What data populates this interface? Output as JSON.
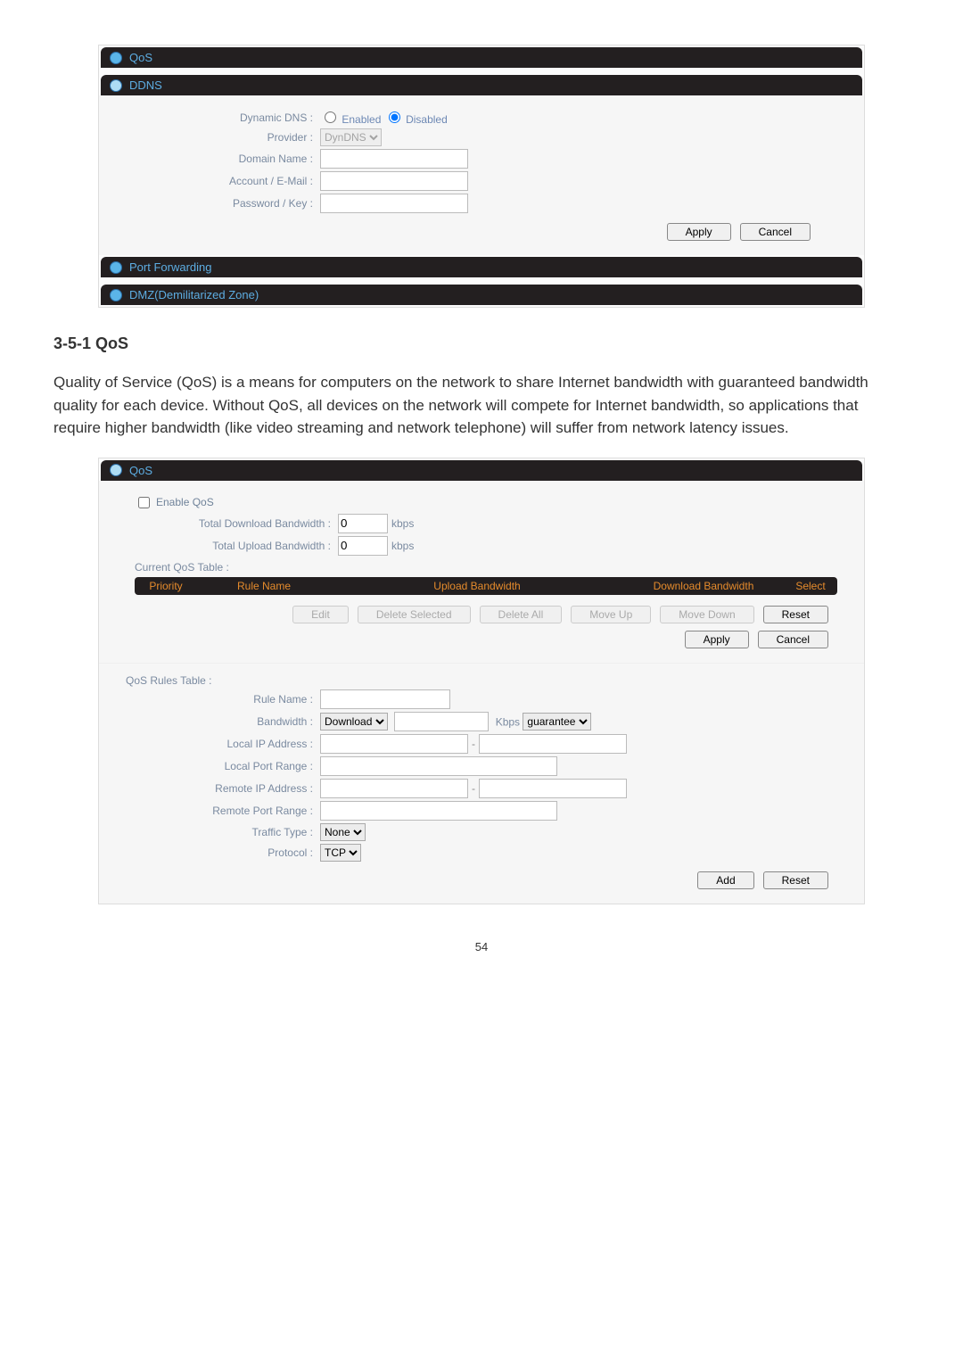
{
  "panel1": {
    "headers": {
      "qos": "QoS",
      "ddns": "DDNS",
      "portfwd": "Port Forwarding",
      "dmz": "DMZ(Demilitarized Zone)"
    },
    "ddns": {
      "dynamic_dns_label": "Dynamic DNS :",
      "enabled_label": "Enabled",
      "disabled_label": "Disabled",
      "provider_label": "Provider :",
      "provider_value": "DynDNS",
      "domain_label": "Domain Name :",
      "account_label": "Account / E-Mail :",
      "password_label": "Password / Key :",
      "apply": "Apply",
      "cancel": "Cancel"
    }
  },
  "section_heading": "3-5-1 QoS",
  "body_paragraph": "Quality of Service (QoS) is a means for computers on the network to share Internet bandwidth with guaranteed bandwidth quality for each device. Without QoS, all devices on the network will compete for Internet bandwidth, so applications that require higher bandwidth (like video streaming and network telephone) will suffer from network latency issues.",
  "panel2": {
    "header_qos": "QoS",
    "enable_qos_label": "Enable QoS",
    "tdb_label": "Total Download Bandwidth :",
    "tdb_value": "0",
    "tub_label": "Total Upload Bandwidth :",
    "tub_value": "0",
    "kbps": "kbps",
    "Kbps": "Kbps",
    "current_table_label": "Current QoS Table :",
    "th_priority": "Priority",
    "th_rule": "Rule Name",
    "th_upload": "Upload Bandwidth",
    "th_download": "Download Bandwidth",
    "th_select": "Select",
    "btn_edit": "Edit",
    "btn_delsel": "Delete Selected",
    "btn_delall": "Delete All",
    "btn_moveup": "Move Up",
    "btn_movedown": "Move Down",
    "btn_reset": "Reset",
    "btn_apply": "Apply",
    "btn_cancel": "Cancel",
    "rules_label": "QoS Rules Table :",
    "rule_name_label": "Rule Name :",
    "bandwidth_label": "Bandwidth :",
    "bandwidth_dir": "Download",
    "bandwidth_mode": "guarantee",
    "local_ip_label": "Local IP Address :",
    "local_port_label": "Local Port Range :",
    "remote_ip_label": "Remote IP Address :",
    "remote_port_label": "Remote Port Range :",
    "traffic_type_label": "Traffic Type :",
    "traffic_type_value": "None",
    "protocol_label": "Protocol :",
    "protocol_value": "TCP",
    "btn_add": "Add",
    "btn_reset2": "Reset"
  },
  "page_number": "54"
}
